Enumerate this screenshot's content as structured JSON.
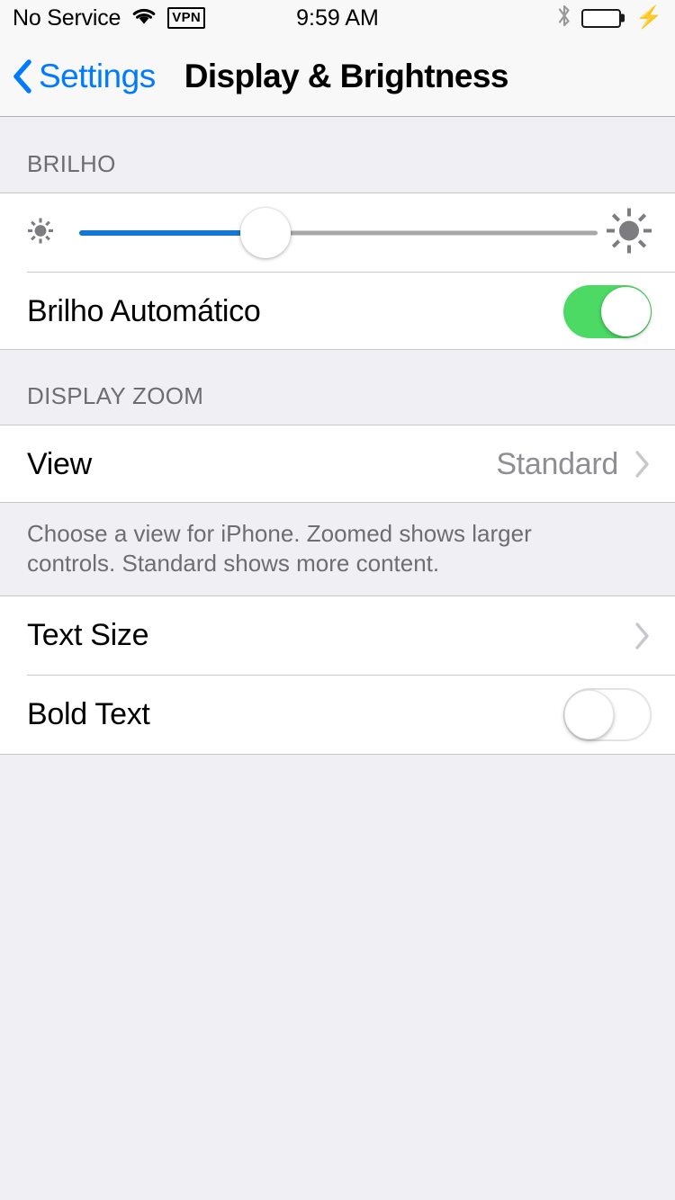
{
  "status_bar": {
    "carrier": "No Service",
    "wifi_icon": "wifi-icon",
    "vpn_label": "VPN",
    "time": "9:59 AM",
    "bluetooth_icon": "bluetooth-icon",
    "battery_icon": "battery-icon",
    "charging_icon": "lightning-bolt-icon",
    "battery_color": "#4CD964"
  },
  "nav_bar": {
    "back_label": "Settings",
    "back_icon": "chevron-left-icon",
    "title": "Display & Brightness",
    "tint_color": "#007AFF"
  },
  "sections": {
    "brightness": {
      "header": "BRILHO",
      "slider": {
        "name": "brightness-slider",
        "value_percent": 36,
        "min_icon": "sun-small-icon",
        "max_icon": "sun-large-icon",
        "fill_color": "#1278D4",
        "track_color": "#A8A8A8"
      },
      "auto_brightness": {
        "label": "Brilho Automático",
        "toggle_state": "on",
        "toggle_color": "#4CD964"
      }
    },
    "display_zoom": {
      "header": "DISPLAY ZOOM",
      "view_row": {
        "label": "View",
        "value": "Standard",
        "chevron_icon": "chevron-right-icon"
      },
      "footer": "Choose a view for iPhone. Zoomed shows larger controls. Standard shows more content."
    },
    "text": {
      "text_size_row": {
        "label": "Text Size",
        "chevron_icon": "chevron-right-icon"
      },
      "bold_text_row": {
        "label": "Bold Text",
        "toggle_state": "off"
      }
    }
  }
}
